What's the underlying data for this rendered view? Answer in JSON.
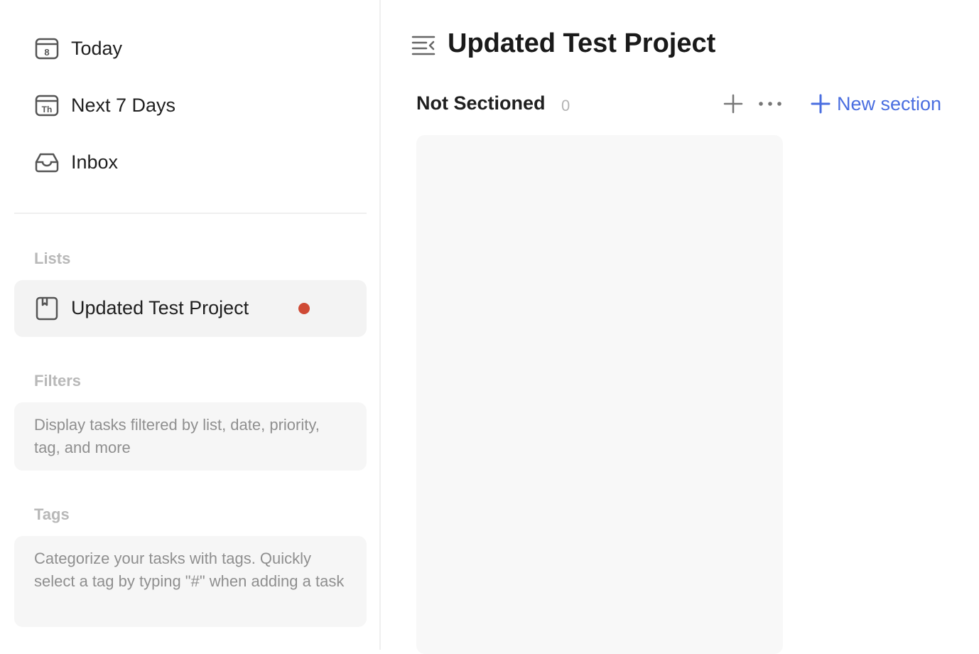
{
  "sidebar": {
    "smart_lists": [
      {
        "label": "Today",
        "icon": "calendar-today-icon",
        "icon_text": "8"
      },
      {
        "label": "Next 7 Days",
        "icon": "calendar-week-icon",
        "icon_text": "Th"
      },
      {
        "label": "Inbox",
        "icon": "inbox-icon"
      }
    ],
    "lists_title": "Lists",
    "lists": [
      {
        "label": "Updated Test Project",
        "icon": "project-list-icon",
        "dot_color": "#cf4a35"
      }
    ],
    "filters_title": "Filters",
    "filters_hint": "Display tasks filtered by list, date, priority, tag, and more",
    "tags_title": "Tags",
    "tags_hint": "Categorize your tasks with tags. Quickly select a tag by typing \"#\" when adding a task"
  },
  "main": {
    "title": "Updated Test Project",
    "column": {
      "title": "Not Sectioned",
      "count": "0"
    },
    "new_section_label": "New section",
    "accent_color": "#4a6ee0"
  }
}
